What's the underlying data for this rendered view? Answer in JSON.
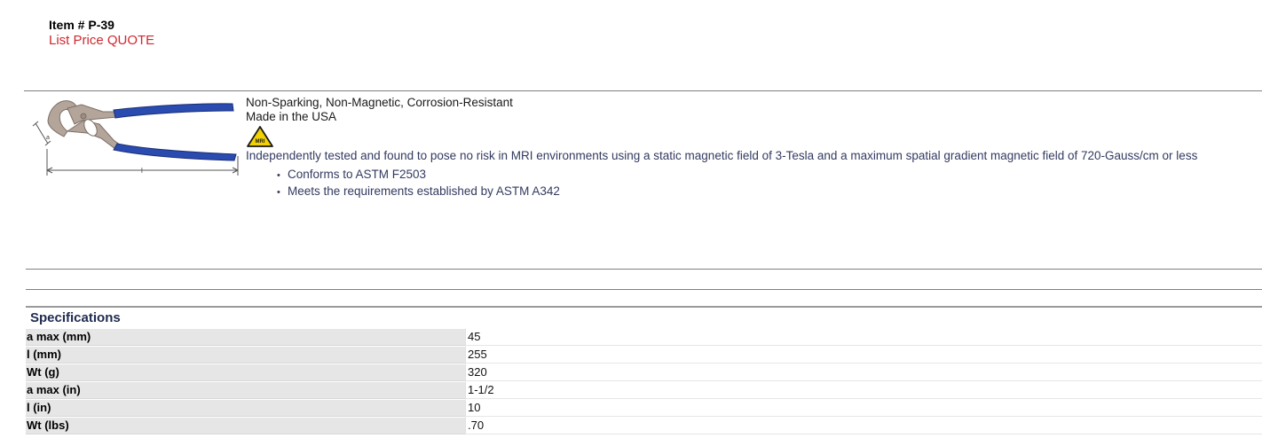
{
  "item": {
    "number_label": "Item # P-39",
    "price_label": "List Price QUOTE"
  },
  "product": {
    "image_icon": "tongue-and-groove-pliers-diagram",
    "dimension_a_label": "a",
    "dimension_l_label": "l",
    "features": [
      "Non-Sparking, Non-Magnetic, Corrosion-Resistant",
      "Made in the USA"
    ],
    "mri_badge_icon": "mri-safe-warning-icon",
    "mri_badge_text": "MRI",
    "mri_statement": "Independently tested and found to pose no risk in MRI environments using a static magnetic field of 3-Tesla and a maximum spatial gradient magnetic field of 720-Gauss/cm or less",
    "bullets": [
      "Conforms to ASTM F2503",
      "Meets the requirements established by ASTM A342"
    ]
  },
  "specifications": {
    "title": "Specifications",
    "rows": [
      {
        "label": "a max (mm)",
        "value": "45"
      },
      {
        "label": "l (mm)",
        "value": "255"
      },
      {
        "label": "Wt (g)",
        "value": "320"
      },
      {
        "label": "a max (in)",
        "value": "1-1/2"
      },
      {
        "label": "l (in)",
        "value": "10"
      },
      {
        "label": "Wt (lbs)",
        "value": ".70"
      }
    ]
  },
  "colors": {
    "price_red": "#d0282f",
    "handle_blue": "#2a4bb0",
    "tool_metal": "#b3a59a",
    "text_navy": "#333a60",
    "spec_label_bg": "#e6e6e6",
    "mri_yellow": "#f2d200"
  }
}
